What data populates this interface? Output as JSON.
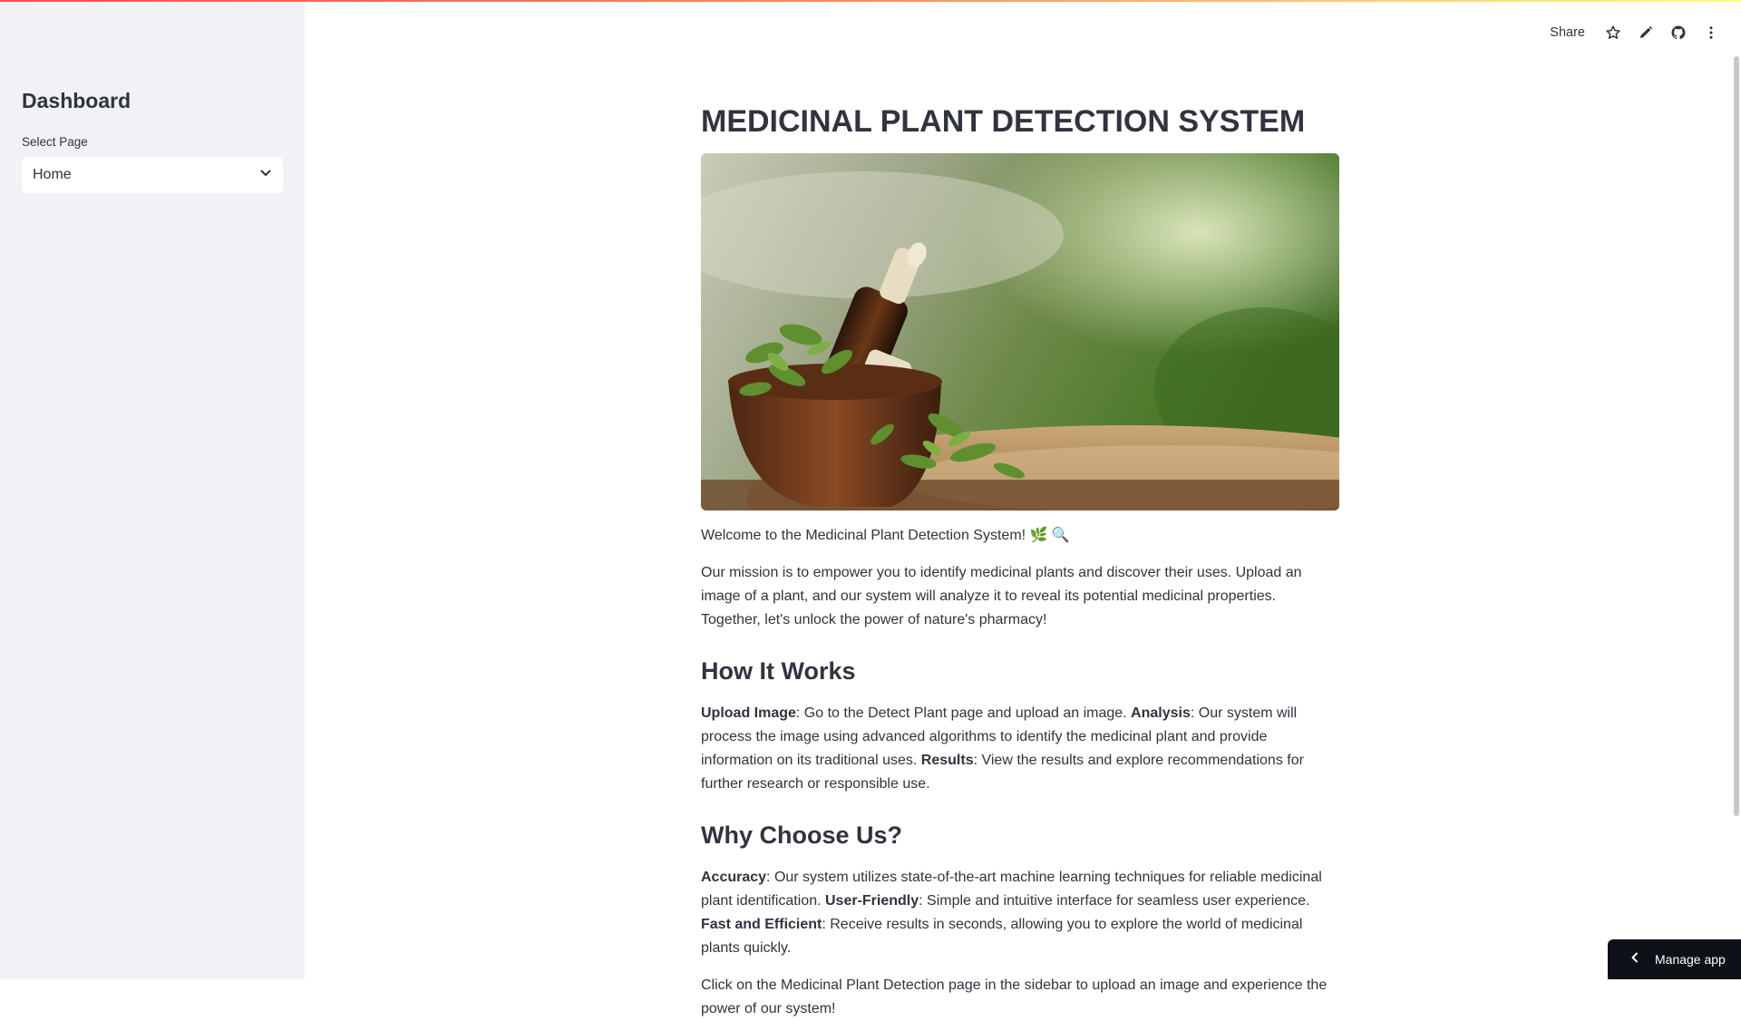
{
  "colors": {
    "sidebar_bg": "#f0f2f6",
    "text": "#31333f",
    "manage_bg": "#0e1117",
    "stripe_start": "#ff4b4b",
    "stripe_end": "#fffd80"
  },
  "sidebar": {
    "title": "Dashboard",
    "select_label": "Select Page",
    "select_value": "Home",
    "select_icon": "chevron-down-icon"
  },
  "header": {
    "share_label": "Share",
    "icons": [
      "star-icon",
      "pencil-icon",
      "github-icon",
      "more-vertical-icon"
    ]
  },
  "main": {
    "title": "MEDICINAL PLANT DETECTION SYSTEM",
    "hero_image": "herbs-in-wooden-mortar-photo",
    "welcome": "Welcome to the Medicinal Plant Detection System! 🌿 🔍",
    "mission": "Our mission is to empower you to identify medicinal plants and discover their uses. Upload an image of a plant, and our system will analyze it to reveal its potential medicinal properties. Together, let's unlock the power of nature's pharmacy!",
    "how_heading": "How It Works",
    "how": {
      "upload_label": "Upload Image",
      "upload_text": ": Go to the Detect Plant page and upload an image. ",
      "analysis_label": "Analysis",
      "analysis_text": ": Our system will process the image using advanced algorithms to identify the medicinal plant and provide information on its traditional uses. ",
      "results_label": "Results",
      "results_text": ": View the results and explore recommendations for further research or responsible use."
    },
    "why_heading": "Why Choose Us?",
    "why": {
      "accuracy_label": "Accuracy",
      "accuracy_text": ": Our system utilizes state-of-the-art machine learning techniques for reliable medicinal plant identification. ",
      "friendly_label": "User-Friendly",
      "friendly_text": ": Simple and intuitive interface for seamless user experience. ",
      "fast_label": "Fast and Efficient",
      "fast_text": ": Receive results in seconds, allowing you to explore the world of medicinal plants quickly."
    },
    "final": "Click on the Medicinal Plant Detection page in the sidebar to upload an image and experience the power of our system!"
  },
  "manage_app": {
    "label": "Manage app",
    "icon": "chevron-left-icon"
  }
}
